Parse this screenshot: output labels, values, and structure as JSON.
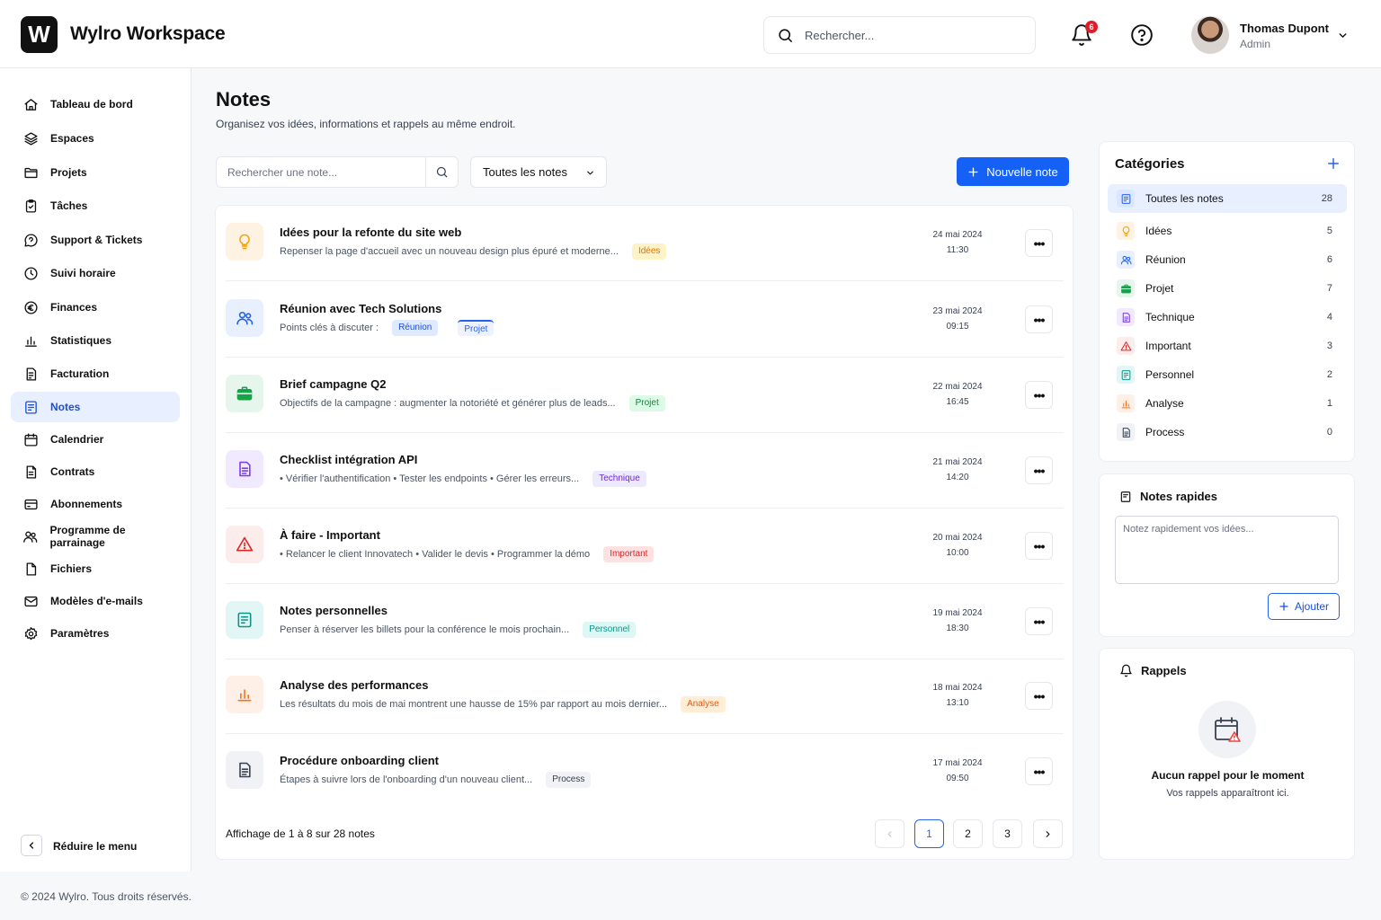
{
  "app": {
    "logo_letter": "W",
    "title": "Wylro Workspace"
  },
  "header": {
    "search_placeholder": "Rechercher...",
    "notification_count": "6",
    "user": {
      "name": "Thomas Dupont",
      "role": "Admin"
    }
  },
  "sidebar": {
    "items": [
      {
        "label": "Tableau de bord",
        "icon": "home-icon"
      },
      {
        "label": "Espaces",
        "icon": "layers-icon"
      },
      {
        "label": "Projets",
        "icon": "folder-icon"
      },
      {
        "label": "Tâches",
        "icon": "clipboard-check-icon"
      },
      {
        "label": "Support & Tickets",
        "icon": "chat-icon"
      },
      {
        "label": "Suivi horaire",
        "icon": "clock-icon"
      },
      {
        "label": "Finances",
        "icon": "euro-icon"
      },
      {
        "label": "Statistiques",
        "icon": "bar-chart-icon"
      },
      {
        "label": "Facturation",
        "icon": "invoice-icon"
      },
      {
        "label": "Notes",
        "icon": "note-icon",
        "active": true
      },
      {
        "label": "Calendrier",
        "icon": "calendar-icon"
      },
      {
        "label": "Contrats",
        "icon": "contract-icon"
      },
      {
        "label": "Abonnements",
        "icon": "card-icon"
      },
      {
        "label": "Programme de parrainage",
        "icon": "users-icon"
      },
      {
        "label": "Fichiers",
        "icon": "file-icon"
      },
      {
        "label": "Modèles d'e-mails",
        "icon": "mail-icon"
      },
      {
        "label": "Paramètres",
        "icon": "gear-icon"
      }
    ],
    "collapse_label": "Réduire le menu"
  },
  "footer": {
    "copyright": "© 2024 Wylro. Tous droits réservés."
  },
  "main": {
    "title": "Notes",
    "subtitle": "Organisez vos idées, informations et rappels au même endroit.",
    "search_placeholder": "Rechercher une note...",
    "filter_value": "Toutes les notes",
    "new_note_label": "Nouvelle note",
    "notes": [
      {
        "title": "Idées pour la refonte du site web",
        "desc": "Repenser la page d'accueil avec un nouveau design plus épuré et moderne...",
        "tags": [
          "Idées"
        ],
        "date": "24 mai 2024",
        "time": "11:30",
        "icon": "lightbulb-icon",
        "color": "#f59e0b",
        "bg": "#fef3e2",
        "tag_color": "#d97706",
        "tag_bg": "#fef3c7"
      },
      {
        "title": "Réunion avec Tech Solutions",
        "desc": "Points clés à discuter :",
        "tags": [
          "Réunion",
          "Projet"
        ],
        "date": "23 mai 2024",
        "time": "09:15",
        "icon": "users-icon",
        "color": "#2563eb",
        "bg": "#e8efff",
        "tag_color": "#1d4ed8",
        "tag_bg": "#e0eaff"
      },
      {
        "title": "Brief campagne Q2",
        "desc": "Objectifs de la campagne : augmenter la notoriété et générer plus de leads...",
        "tags": [
          "Projet"
        ],
        "date": "22 mai 2024",
        "time": "16:45",
        "icon": "briefcase-icon",
        "color": "#16a34a",
        "bg": "#e6f6ec",
        "tag_color": "#15803d",
        "tag_bg": "#dcfce7"
      },
      {
        "title": "Checklist intégration API",
        "desc": "• Vérifier l'authentification   • Tester les endpoints   • Gérer les erreurs...",
        "tags": [
          "Technique"
        ],
        "date": "21 mai 2024",
        "time": "14:20",
        "icon": "document-icon",
        "color": "#7c3aed",
        "bg": "#f1eafe",
        "tag_color": "#6d28d9",
        "tag_bg": "#ede9fe"
      },
      {
        "title": "À faire - Important",
        "desc": "• Relancer le client Innovatech   • Valider le devis   • Programmer la démo",
        "tags": [
          "Important"
        ],
        "date": "20 mai 2024",
        "time": "10:00",
        "icon": "warning-icon",
        "color": "#dc2626",
        "bg": "#fdecec",
        "tag_color": "#dc2626",
        "tag_bg": "#fee2e2"
      },
      {
        "title": "Notes personnelles",
        "desc": "Penser à réserver les billets pour la conférence le mois prochain...",
        "tags": [
          "Personnel"
        ],
        "date": "19 mai 2024",
        "time": "18:30",
        "icon": "note-icon",
        "color": "#0d9488",
        "bg": "#e2f6f5",
        "tag_color": "#0f9488",
        "tag_bg": "#dcf7f4"
      },
      {
        "title": "Analyse des performances",
        "desc": "Les résultats du mois de mai montrent une hausse de 15% par rapport au mois dernier...",
        "tags": [
          "Analyse"
        ],
        "date": "18 mai 2024",
        "time": "13:10",
        "icon": "bar-chart-icon",
        "color": "#f97316",
        "bg": "#fef0e6",
        "tag_color": "#ea580c",
        "tag_bg": "#ffedd5"
      },
      {
        "title": "Procédure onboarding client",
        "desc": "Étapes à suivre lors de l'onboarding d'un nouveau client...",
        "tags": [
          "Process"
        ],
        "date": "17 mai 2024",
        "time": "09:50",
        "icon": "document-icon",
        "color": "#374151",
        "bg": "#f0f2f5",
        "tag_color": "#374151",
        "tag_bg": "#f0f2f5"
      }
    ],
    "pagination": {
      "info": "Affichage de 1 à 8 sur 28 notes",
      "pages": [
        "1",
        "2",
        "3"
      ],
      "current": "1"
    }
  },
  "categories": {
    "title": "Catégories",
    "items": [
      {
        "label": "Toutes les notes",
        "count": "28",
        "active": true,
        "icon": "note-icon",
        "color": "#2563eb",
        "bg": "#dbe6ff"
      },
      {
        "label": "Idées",
        "count": "5",
        "icon": "lightbulb-icon",
        "color": "#f59e0b",
        "bg": "#fef3e2"
      },
      {
        "label": "Réunion",
        "count": "6",
        "icon": "users-icon",
        "color": "#2563eb",
        "bg": "#e8efff"
      },
      {
        "label": "Projet",
        "count": "7",
        "icon": "briefcase-icon",
        "color": "#16a34a",
        "bg": "#e6f6ec"
      },
      {
        "label": "Technique",
        "count": "4",
        "icon": "document-icon",
        "color": "#7c3aed",
        "bg": "#f1eafe"
      },
      {
        "label": "Important",
        "count": "3",
        "icon": "warning-icon",
        "color": "#dc2626",
        "bg": "#fdecec"
      },
      {
        "label": "Personnel",
        "count": "2",
        "icon": "note-icon",
        "color": "#0d9488",
        "bg": "#e2f6f5"
      },
      {
        "label": "Analyse",
        "count": "1",
        "icon": "bar-chart-icon",
        "color": "#f97316",
        "bg": "#fef0e6"
      },
      {
        "label": "Process",
        "count": "0",
        "icon": "document-icon",
        "color": "#374151",
        "bg": "#f0f2f5"
      }
    ]
  },
  "quick_notes": {
    "title": "Notes rapides",
    "placeholder": "Notez rapidement vos idées...",
    "add_label": "Ajouter"
  },
  "reminders": {
    "title": "Rappels",
    "empty_title": "Aucun rappel pour le moment",
    "empty_sub": "Vos rappels apparaîtront ici."
  }
}
